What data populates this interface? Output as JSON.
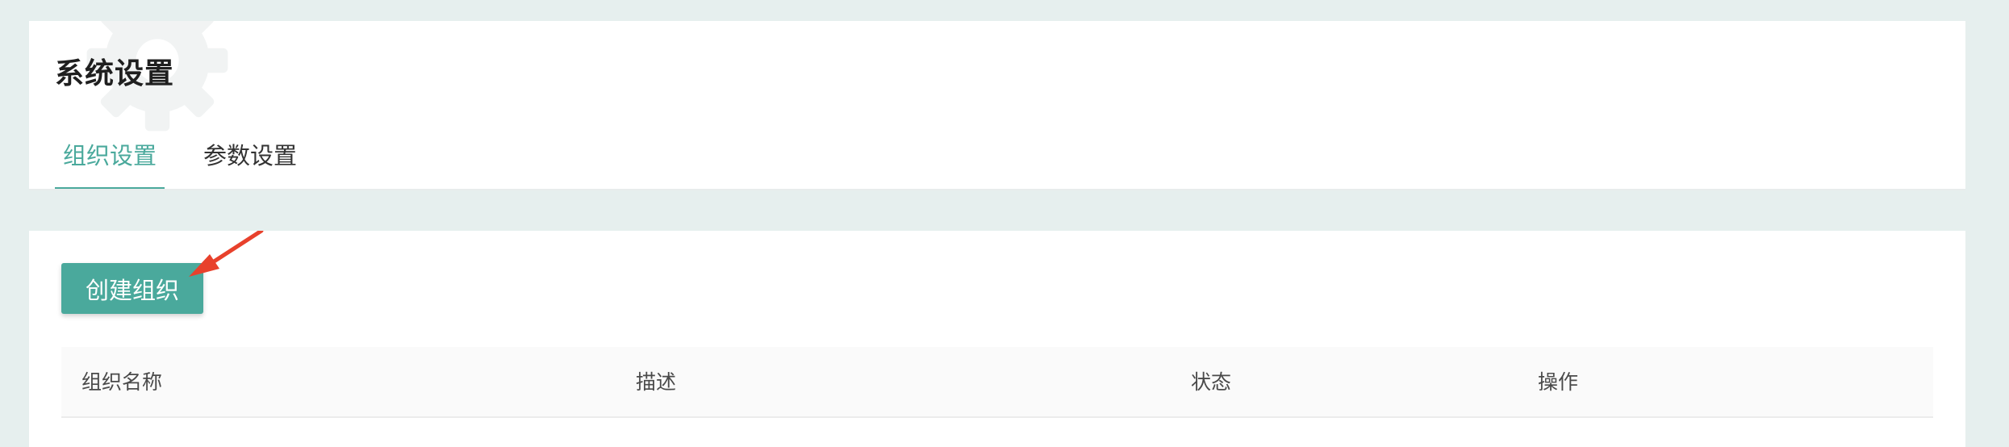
{
  "header": {
    "title": "系统设置",
    "tabs": [
      {
        "label": "组织设置",
        "active": true
      },
      {
        "label": "参数设置",
        "active": false
      }
    ]
  },
  "toolbar": {
    "create_label": "创建组织"
  },
  "table": {
    "columns": [
      "组织名称",
      "描述",
      "状态",
      "操作"
    ]
  },
  "colors": {
    "accent": "#4aa99c",
    "page_background": "#e6efee",
    "annotation_arrow": "#e8412c"
  },
  "icons": {
    "watermark": "gear-icon",
    "annotation": "arrow-annotation"
  }
}
